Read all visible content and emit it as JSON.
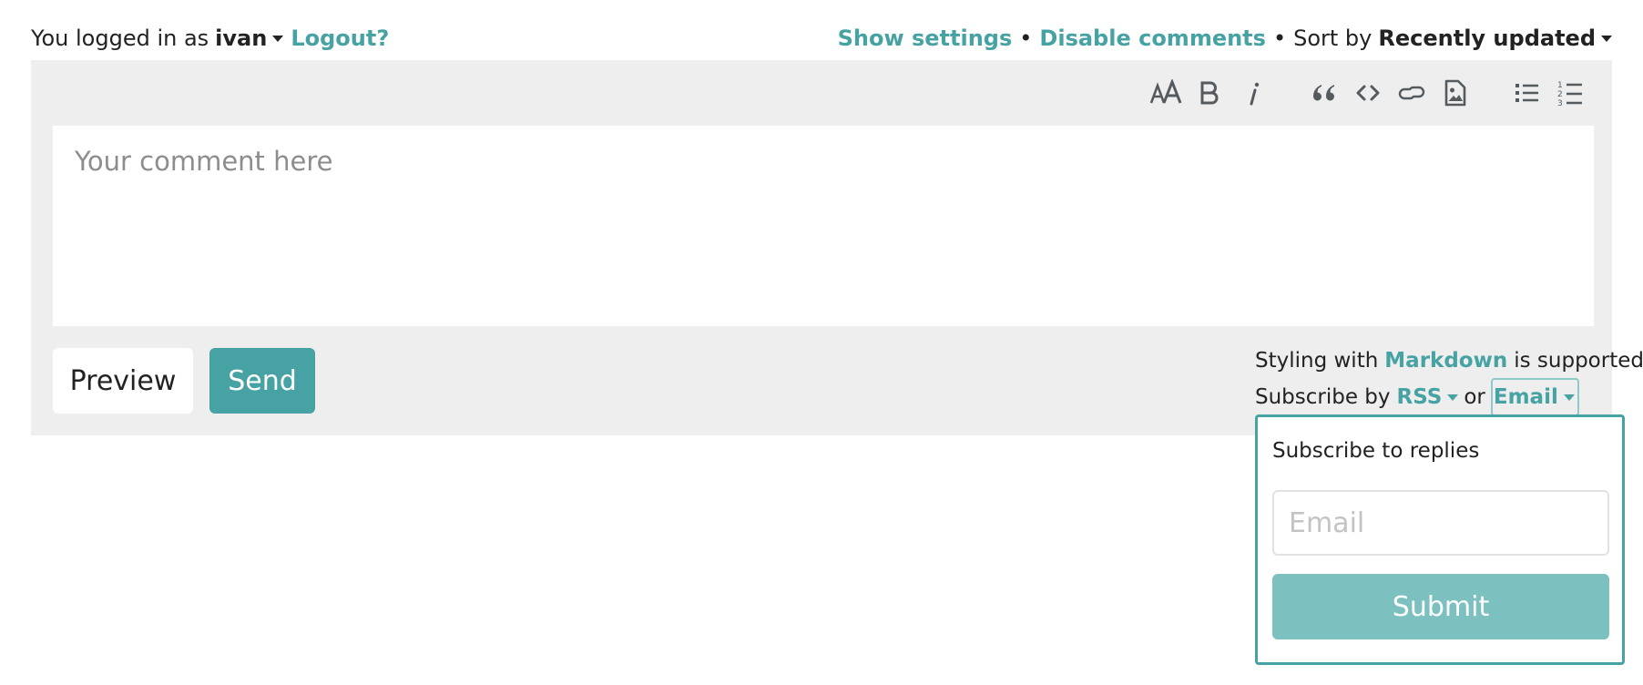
{
  "auth": {
    "prefix": "You logged in as",
    "username": "ivan",
    "logout": "Logout?"
  },
  "settings": {
    "show_settings": "Show settings",
    "bullet": "•",
    "disable_comments": "Disable comments",
    "sort_prefix": "Sort by",
    "sort_value": "Recently updated"
  },
  "toolbar": {
    "icons": [
      "heading-icon",
      "bold-icon",
      "italic-icon",
      "quote-icon",
      "code-icon",
      "link-icon",
      "image-icon",
      "bullet-list-icon",
      "numbered-list-icon"
    ]
  },
  "editor": {
    "placeholder": "Your comment here"
  },
  "actions": {
    "preview": "Preview",
    "send": "Send"
  },
  "help": {
    "styling_prefix": "Styling with",
    "markdown": "Markdown",
    "styling_suffix": "is supported",
    "subscribe_prefix": "Subscribe by",
    "rss": "RSS",
    "or": "or",
    "email": "Email"
  },
  "subscribe_dropdown": {
    "title": "Subscribe to replies",
    "email_placeholder": "Email",
    "submit": "Submit"
  },
  "colors": {
    "accent": "#47a3a3",
    "accent_light": "#7cc0c0",
    "panel_bg": "#eeeeee"
  }
}
